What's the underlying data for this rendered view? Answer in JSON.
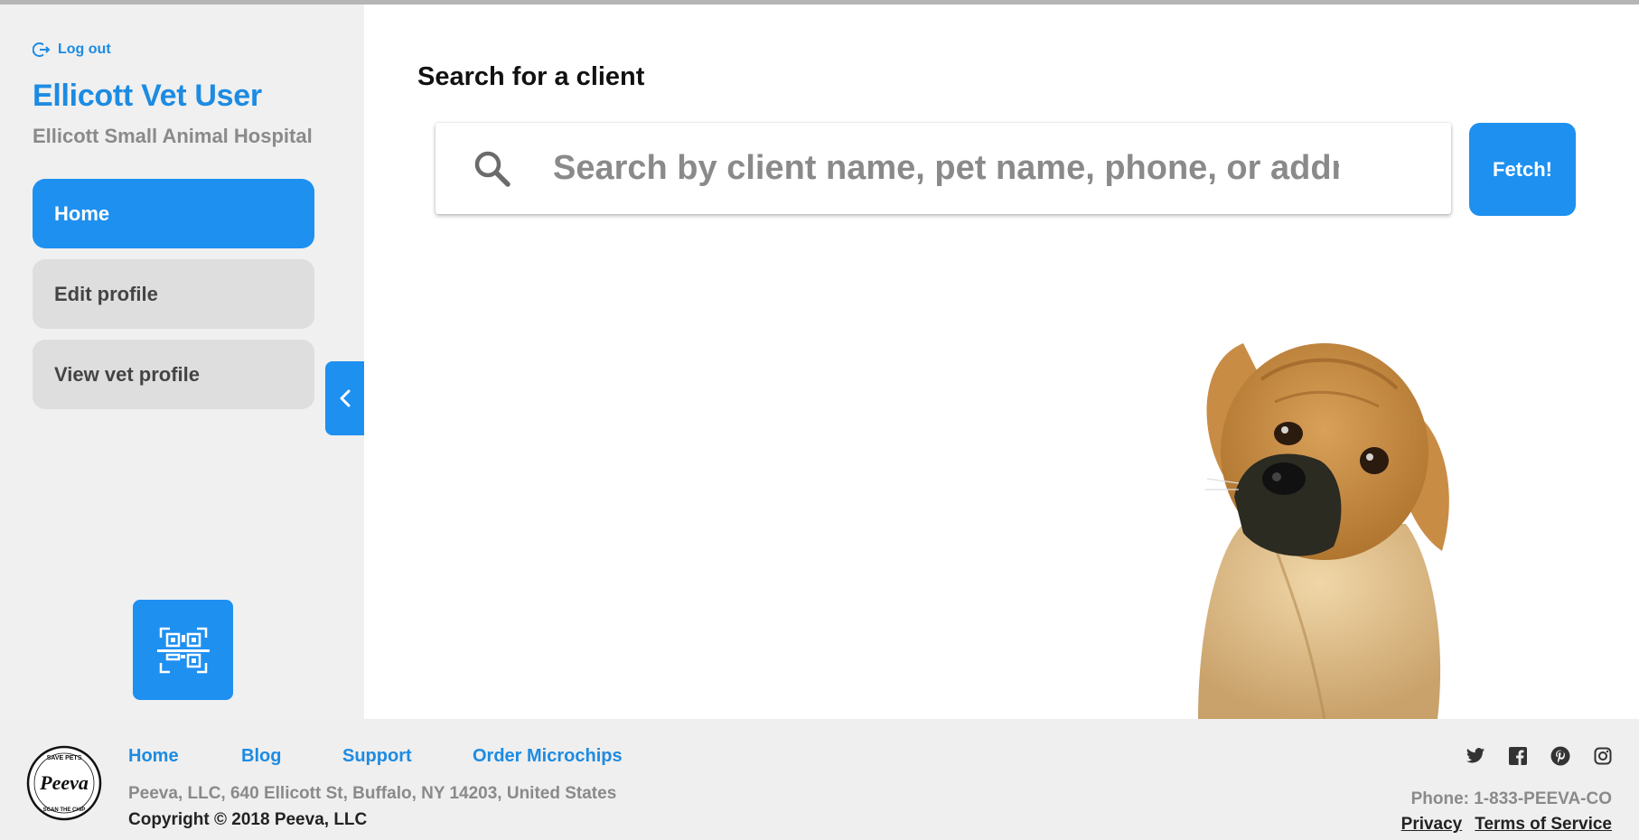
{
  "sidebar": {
    "logout_label": "Log out",
    "user_name": "Ellicott Vet User",
    "clinic_name": "Ellicott Small Animal Hospital",
    "nav": {
      "home": "Home",
      "edit_profile": "Edit profile",
      "view_vet_profile": "View vet profile"
    },
    "icons": {
      "logout": "logout-icon",
      "collapse": "chevron-left-icon",
      "qr_scan": "qr-scan-icon"
    }
  },
  "main": {
    "search_title": "Search for a client",
    "search_placeholder": "Search by client name, pet name, phone, or address",
    "search_value": "",
    "fetch_label": "Fetch!",
    "image": "puppy-photo"
  },
  "footer": {
    "logo_text": "Peeva",
    "logo_top_text": "SAVE PETS",
    "logo_bottom_text": "SCAN THE CHIP",
    "links": {
      "home": "Home",
      "blog": "Blog",
      "support": "Support",
      "order_microchips": "Order Microchips"
    },
    "address": "Peeva, LLC, 640 Ellicott St, Buffalo, NY 14203, United States",
    "copyright": "Copyright © 2018 Peeva, LLC",
    "phone": "Phone: 1-833-PEEVA-CO",
    "privacy": "Privacy",
    "terms": "Terms of Service",
    "socials": [
      "twitter-icon",
      "facebook-icon",
      "pinterest-icon",
      "instagram-icon"
    ]
  },
  "colors": {
    "accent": "#1e90f0",
    "link": "#1d8be2",
    "sidebar_bg": "#f0f0f0",
    "nav_inactive": "#dedede",
    "muted_text": "#8a8a8a"
  }
}
